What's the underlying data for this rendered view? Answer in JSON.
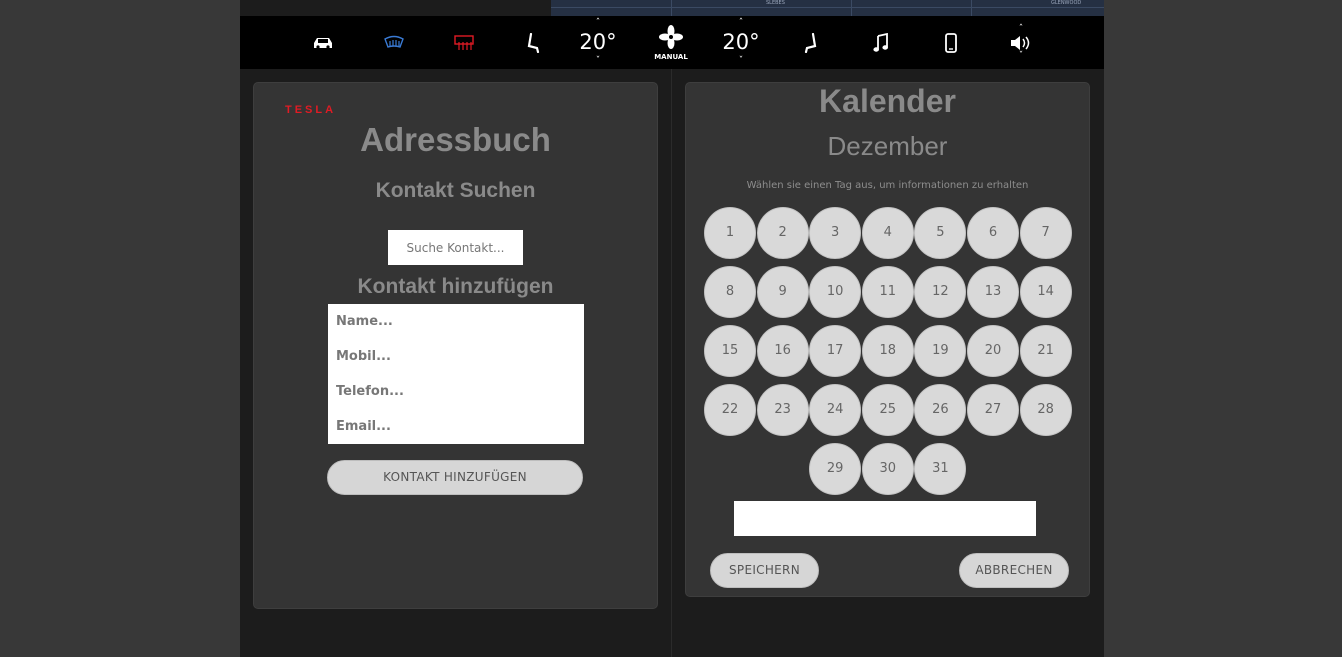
{
  "map": {
    "labels": [
      "SLEBES",
      "GLENWOOD"
    ]
  },
  "topbar": {
    "icons": [
      "car-icon",
      "front-defrost-icon",
      "rear-defrost-icon",
      "seat-heater-left-icon",
      "fan-icon",
      "seat-heater-right-icon",
      "music-icon",
      "phone-icon",
      "volume-icon"
    ],
    "left_temp": "20°",
    "right_temp": "20°",
    "fan_mode": "MANUAL",
    "caret_up": "^",
    "caret_down": "v",
    "colors": {
      "front_defrost": "#3a7bd5",
      "rear_defrost": "#e01b24"
    }
  },
  "addressbook": {
    "logo_text": "TESLA",
    "title": "Adressbuch",
    "search_heading": "Kontakt Suchen",
    "search_placeholder": "Suche Kontakt...",
    "add_heading": "Kontakt hinzufügen",
    "fields": {
      "name_placeholder": "Name...",
      "mobile_placeholder": "Mobil...",
      "phone_placeholder": "Telefon...",
      "email_placeholder": "Email..."
    },
    "add_button": "KONTAKT HINZUFÜGEN"
  },
  "calendar": {
    "title": "Kalender",
    "month": "Dezember",
    "hint": "Wählen sie einen Tag aus, um informationen zu erhalten",
    "days": [
      "1",
      "2",
      "3",
      "4",
      "5",
      "6",
      "7",
      "8",
      "9",
      "10",
      "11",
      "12",
      "13",
      "14",
      "15",
      "16",
      "17",
      "18",
      "19",
      "20",
      "21",
      "22",
      "23",
      "24",
      "25",
      "26",
      "27",
      "28",
      "29",
      "30",
      "31"
    ],
    "note_value": "",
    "save_button": "SPEICHERN",
    "cancel_button": "ABBRECHEN"
  }
}
